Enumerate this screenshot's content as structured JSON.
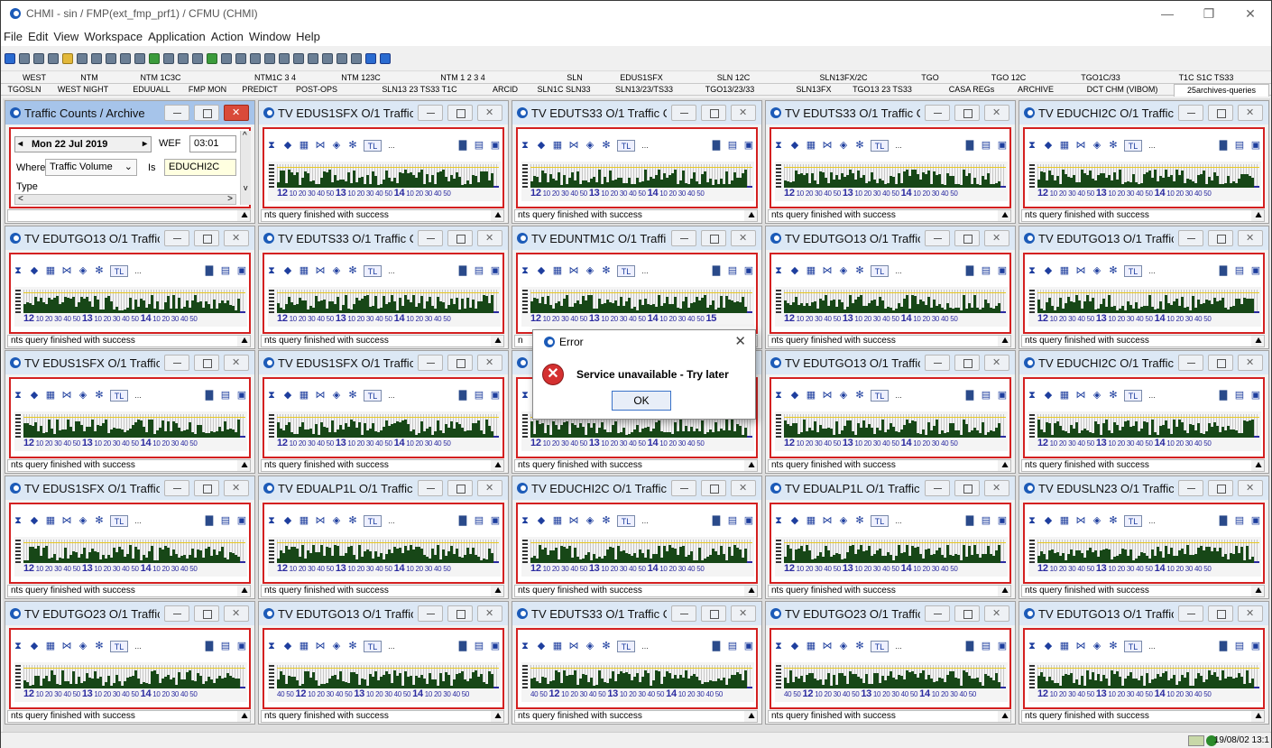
{
  "window": {
    "title": "CHMI - sin / FMP(ext_fmp_prf1) / CFMU (CHMI)"
  },
  "menu": [
    "File",
    "Edit",
    "View",
    "Workspace",
    "Application",
    "Action",
    "Window",
    "Help"
  ],
  "tabs_row1": [
    "WEST",
    "NTM",
    "NTM 1C3C",
    "NTM1C 3 4",
    "NTM 123C",
    "NTM 1 2 3 4",
    "SLN",
    "EDUS1SFX",
    "SLN 12C",
    "SLN13FX/2C",
    "TGO",
    "TGO 12C",
    "TGO1C/33",
    "T1C S1C TS33"
  ],
  "tabs_row2": [
    "TGOSLN",
    "WEST NIGHT",
    "EDUUALL",
    "FMP MON",
    "PREDICT",
    "POST-OPS",
    "SLN13 23 TS33 T1C",
    "ARCID",
    "SLN1C SLN33",
    "SLN13/23/TS33",
    "TGO13/23/33",
    "SLN13FX",
    "TGO13 23 TS33",
    "CASA REGs",
    "ARCHIVE",
    "DCT CHM (VIBOM)",
    "25archives-queries"
  ],
  "archive_panel": {
    "title": "Traffic Counts / Archive",
    "date": "Mon 22 Jul 2019",
    "wef_label": "WEF",
    "wef_value": "03:01",
    "where_label": "Where",
    "where_value": "Traffic Volume",
    "is_label": "Is",
    "is_value": "EDUCHI2C",
    "type_label": "Type"
  },
  "panels": [
    {
      "title": "TV EDUS1SFX O/1 Traffic ...",
      "status": "nts query finished with success",
      "axis": [
        "12",
        "10",
        "20",
        "30",
        "40",
        "50",
        "13",
        "10",
        "20",
        "30",
        "40",
        "50",
        "14",
        "10",
        "20",
        "30",
        "40",
        "50"
      ]
    },
    {
      "title": "TV EDUTS33 O/1 Traffic C...",
      "status": "nts query finished with success",
      "axis": [
        "12",
        "10",
        "20",
        "30",
        "40",
        "50",
        "13",
        "10",
        "20",
        "30",
        "40",
        "50",
        "14",
        "10",
        "20",
        "30",
        "40",
        "50"
      ]
    },
    {
      "title": "TV EDUTS33 O/1 Traffic C...",
      "status": "nts query finished with success",
      "axis": [
        "12",
        "10",
        "20",
        "30",
        "40",
        "50",
        "13",
        "10",
        "20",
        "30",
        "40",
        "50",
        "14",
        "10",
        "20",
        "30",
        "40",
        "50"
      ]
    },
    {
      "title": "TV EDUCHI2C O/1 Traffic ...",
      "status": "nts query finished with success",
      "axis": [
        "12",
        "10",
        "20",
        "30",
        "40",
        "50",
        "13",
        "10",
        "20",
        "30",
        "40",
        "50",
        "14",
        "10",
        "20",
        "30",
        "40",
        "50"
      ]
    },
    {
      "title": "TV EDUTGO13 O/1 Traffic...",
      "status": "nts query finished with success",
      "axis": [
        "12",
        "10",
        "20",
        "30",
        "40",
        "50",
        "13",
        "10",
        "20",
        "30",
        "40",
        "50",
        "14",
        "10",
        "20",
        "30",
        "40",
        "50"
      ]
    },
    {
      "title": "TV EDUTS33 O/1 Traffic C...",
      "status": "nts query finished with success",
      "axis": [
        "12",
        "10",
        "20",
        "30",
        "40",
        "50",
        "13",
        "10",
        "20",
        "30",
        "40",
        "50",
        "14",
        "10",
        "20",
        "30",
        "40",
        "50"
      ]
    },
    {
      "title": "TV EDUNTM1C O/1 Traffi...",
      "status": "n",
      "axis": [
        "12",
        "10",
        "20",
        "30",
        "40",
        "50",
        "13",
        "10",
        "20",
        "30",
        "40",
        "50",
        "14",
        "10",
        "20",
        "30",
        "40",
        "50",
        "15"
      ]
    },
    {
      "title": "TV EDUTGO13 O/1 Traffic...",
      "status": "nts query finished with success",
      "axis": [
        "12",
        "10",
        "20",
        "30",
        "40",
        "50",
        "13",
        "10",
        "20",
        "30",
        "40",
        "50",
        "14",
        "10",
        "20",
        "30",
        "40",
        "50"
      ]
    },
    {
      "title": "TV EDUTGO13 O/1 Traffic...",
      "status": "nts query finished with success",
      "axis": [
        "12",
        "10",
        "20",
        "30",
        "40",
        "50",
        "13",
        "10",
        "20",
        "30",
        "40",
        "50",
        "14",
        "10",
        "20",
        "30",
        "40",
        "50"
      ]
    },
    {
      "title": "TV EDUS1SFX O/1 Traffic ...",
      "status": "nts query finished with success",
      "axis": [
        "12",
        "10",
        "20",
        "30",
        "40",
        "50",
        "13",
        "10",
        "20",
        "30",
        "40",
        "50",
        "14",
        "10",
        "20",
        "30",
        "40",
        "50"
      ]
    },
    {
      "title": "TV EDUS1SFX O/1 Traffic ...",
      "status": "nts query finished with success",
      "axis": [
        "12",
        "10",
        "20",
        "30",
        "40",
        "50",
        "13",
        "10",
        "20",
        "30",
        "40",
        "50",
        "14",
        "10",
        "20",
        "30",
        "40",
        "50"
      ]
    },
    {
      "title": "",
      "status": "nts query finished with success",
      "axis": [
        "12",
        "10",
        "20",
        "30",
        "40",
        "50",
        "13",
        "10",
        "20",
        "30",
        "40",
        "50",
        "14",
        "10",
        "20",
        "30",
        "40",
        "50"
      ]
    },
    {
      "title": "TV EDUTGO13 O/1 Traffic...",
      "status": "nts query finished with success",
      "axis": [
        "12",
        "10",
        "20",
        "30",
        "40",
        "50",
        "13",
        "10",
        "20",
        "30",
        "40",
        "50",
        "14",
        "10",
        "20",
        "30",
        "40",
        "50"
      ]
    },
    {
      "title": "TV EDUCHI2C O/1 Traffic ...",
      "status": "nts query finished with success",
      "axis": [
        "12",
        "10",
        "20",
        "30",
        "40",
        "50",
        "13",
        "10",
        "20",
        "30",
        "40",
        "50",
        "14",
        "10",
        "20",
        "30",
        "40",
        "50"
      ]
    },
    {
      "title": "TV EDUS1SFX O/1 Traffic ...",
      "status": "nts query finished with success",
      "axis": [
        "12",
        "10",
        "20",
        "30",
        "40",
        "50",
        "13",
        "10",
        "20",
        "30",
        "40",
        "50",
        "14",
        "10",
        "20",
        "30",
        "40",
        "50"
      ]
    },
    {
      "title": "TV EDUALP1L O/1 Traffic ...",
      "status": "nts query finished with success",
      "axis": [
        "12",
        "10",
        "20",
        "30",
        "40",
        "50",
        "13",
        "10",
        "20",
        "30",
        "40",
        "50",
        "14",
        "10",
        "20",
        "30",
        "40",
        "50"
      ]
    },
    {
      "title": "TV EDUCHI2C O/1 Traffic ...",
      "status": "nts query finished with success",
      "axis": [
        "12",
        "10",
        "20",
        "30",
        "40",
        "50",
        "13",
        "10",
        "20",
        "30",
        "40",
        "50",
        "14",
        "10",
        "20",
        "30",
        "40",
        "50"
      ]
    },
    {
      "title": "TV EDUALP1L O/1 Traffic ...",
      "status": "nts query finished with success",
      "axis": [
        "12",
        "10",
        "20",
        "30",
        "40",
        "50",
        "13",
        "10",
        "20",
        "30",
        "40",
        "50",
        "14",
        "10",
        "20",
        "30",
        "40",
        "50"
      ]
    },
    {
      "title": "TV EDUSLN23 O/1 Traffic ...",
      "status": "nts query finished with success",
      "axis": [
        "12",
        "10",
        "20",
        "30",
        "40",
        "50",
        "13",
        "10",
        "20",
        "30",
        "40",
        "50",
        "14",
        "10",
        "20",
        "30",
        "40",
        "50"
      ]
    },
    {
      "title": "TV EDUTGO23 O/1 Traffic...",
      "status": "nts query finished with success",
      "axis": [
        "12",
        "10",
        "20",
        "30",
        "40",
        "50",
        "13",
        "10",
        "20",
        "30",
        "40",
        "50",
        "14",
        "10",
        "20",
        "30",
        "40",
        "50"
      ]
    },
    {
      "title": "TV EDUTGO13 O/1 Traffic...",
      "status": "nts query finished with success",
      "axis": [
        "40",
        "50",
        "12",
        "10",
        "20",
        "30",
        "40",
        "50",
        "13",
        "10",
        "20",
        "30",
        "40",
        "50",
        "14",
        "10",
        "20",
        "30",
        "40",
        "50"
      ]
    },
    {
      "title": "TV EDUTS33 O/1 Traffic C...",
      "status": "nts query finished with success",
      "axis": [
        "40",
        "50",
        "12",
        "10",
        "20",
        "30",
        "40",
        "50",
        "13",
        "10",
        "20",
        "30",
        "40",
        "50",
        "14",
        "10",
        "20",
        "30",
        "40",
        "50"
      ]
    },
    {
      "title": "TV EDUTGO23 O/1 Traffic...",
      "status": "nts query finished with success",
      "axis": [
        "40",
        "50",
        "12",
        "10",
        "20",
        "30",
        "40",
        "50",
        "13",
        "10",
        "20",
        "30",
        "40",
        "50",
        "14",
        "10",
        "20",
        "30",
        "40",
        "50"
      ]
    },
    {
      "title": "TV EDUTGO13 O/1 Traffic...",
      "status": "nts query finished with success",
      "axis": [
        "12",
        "10",
        "20",
        "30",
        "40",
        "50",
        "13",
        "10",
        "20",
        "30",
        "40",
        "50",
        "14",
        "10",
        "20",
        "30",
        "40",
        "50"
      ]
    }
  ],
  "panel_toolbar": {
    "tl": "TL",
    "dots": "..."
  },
  "dialog": {
    "title": "Error",
    "message": "Service unavailable - Try later",
    "ok": "OK"
  },
  "statusbar": {
    "datetime": "19/08/02 13:1"
  },
  "colors": {
    "panel_border": "#d42020",
    "bars": "#174717",
    "axis": "#2a2aa0",
    "active_title": "#a6c4ea"
  }
}
